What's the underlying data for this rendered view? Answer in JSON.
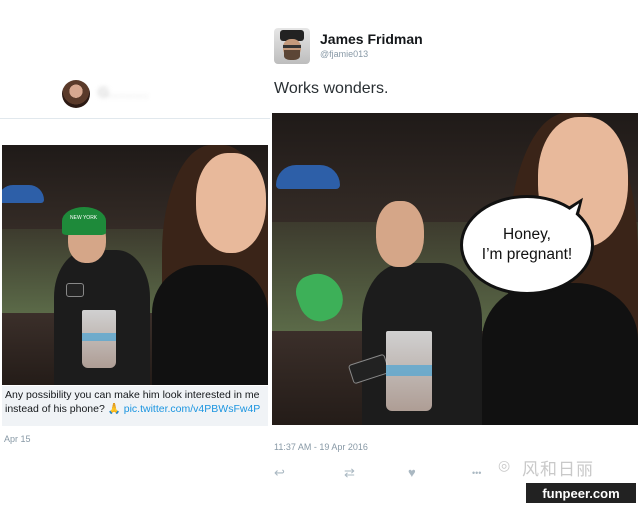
{
  "left_tweet": {
    "name_blurred": "G........",
    "caption_text": "Any possibility you can make him look interested in me instead of his phone? ",
    "caption_emoji": "🙏",
    "caption_link": "pic.twitter.com/v4PBWsFw4P",
    "date": "Apr 15",
    "cap_text": "NEW YORK"
  },
  "right_tweet": {
    "name": "James Fridman",
    "handle": "@fjamie013",
    "text": "Works wonders.",
    "bubble_line1": "Honey,",
    "bubble_line2": "I’m pregnant!",
    "timestamp": "11:37 AM - 19 Apr 2016",
    "actions": {
      "reply_icon": "↩",
      "retweet_icon": "⇄",
      "like_icon": "♥",
      "more_icon": "•••"
    }
  },
  "watermarks": {
    "chinese": "风和日丽",
    "site": "funpeer.com"
  },
  "colors": {
    "link": "#1b95e0",
    "muted": "#8899a6",
    "caption_bg": "#f0f3f6"
  }
}
